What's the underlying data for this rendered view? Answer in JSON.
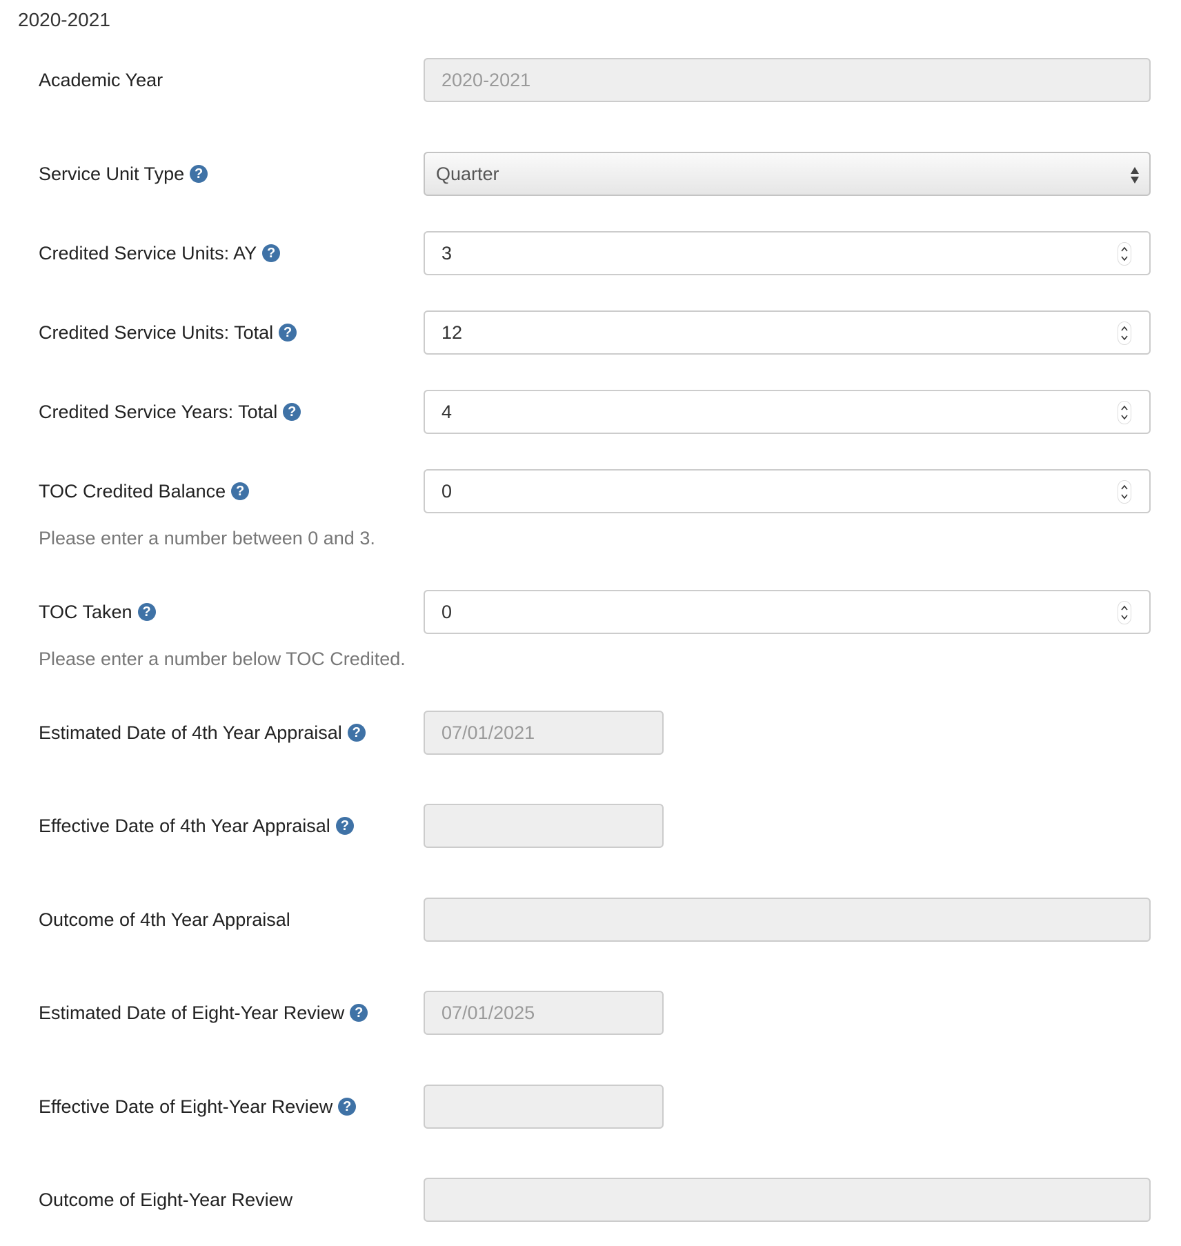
{
  "section": {
    "title": "2020-2021"
  },
  "fields": {
    "academic_year": {
      "label": "Academic Year",
      "value": "2020-2021"
    },
    "service_unit_type": {
      "label": "Service Unit Type",
      "value": "Quarter"
    },
    "credited_units_ay": {
      "label": "Credited Service Units: AY",
      "value": "3"
    },
    "credited_units_total": {
      "label": "Credited Service Units: Total",
      "value": "12"
    },
    "credited_years_total": {
      "label": "Credited Service Years: Total",
      "value": "4"
    },
    "toc_credited_balance": {
      "label": "TOC Credited Balance",
      "value": "0",
      "hint": "Please enter a number between 0 and 3."
    },
    "toc_taken": {
      "label": "TOC Taken",
      "value": "0",
      "hint": "Please enter a number below TOC Credited."
    },
    "est_date_4th_year": {
      "label": "Estimated Date of 4th Year Appraisal",
      "value": "07/01/2021"
    },
    "eff_date_4th_year": {
      "label": "Effective Date of 4th Year Appraisal",
      "value": ""
    },
    "outcome_4th_year": {
      "label": "Outcome of 4th Year Appraisal",
      "value": ""
    },
    "est_date_eight_year": {
      "label": "Estimated Date of Eight-Year Review",
      "value": "07/01/2025"
    },
    "eff_date_eight_year": {
      "label": "Effective Date of Eight-Year Review",
      "value": ""
    },
    "outcome_eight_year": {
      "label": "Outcome of Eight-Year Review",
      "value": ""
    }
  },
  "help_icon_glyph": "?",
  "colors": {
    "help_icon": "#3f72a6",
    "disabled_field": "#eeeeee",
    "hint_text": "#777777"
  }
}
